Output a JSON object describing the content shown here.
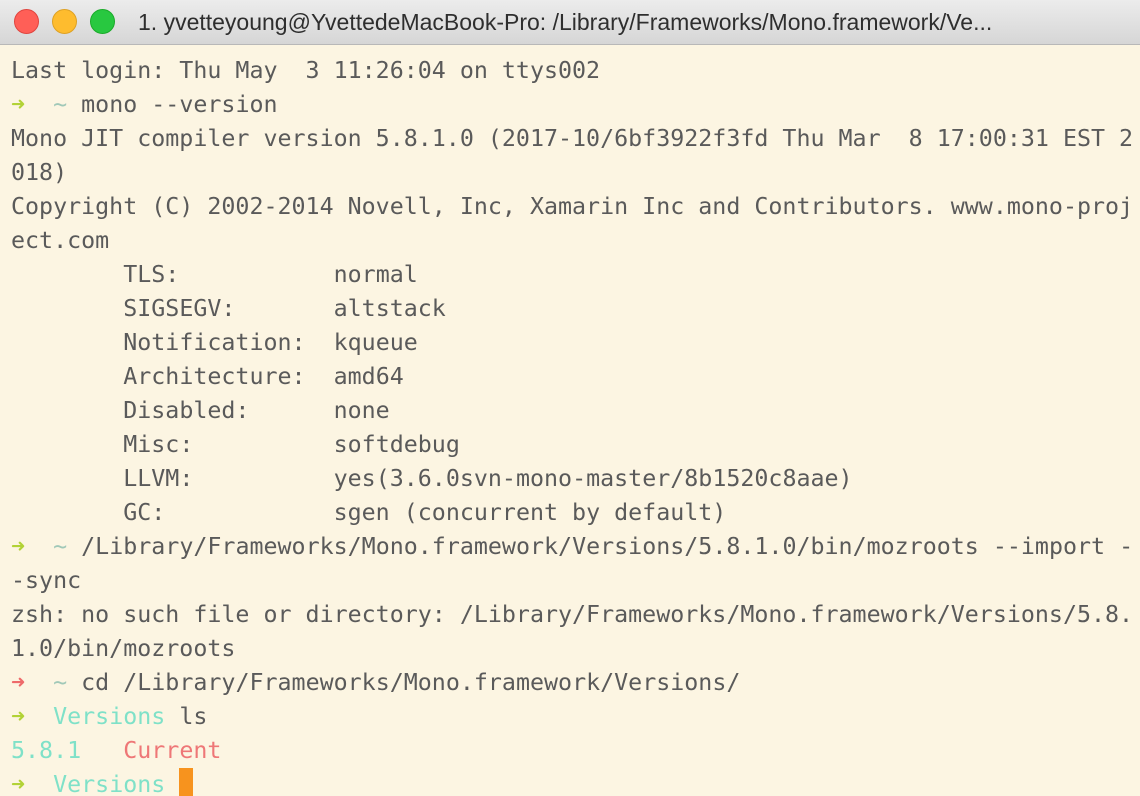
{
  "window": {
    "title": "1. yvetteyoung@YvettedeMacBook-Pro: /Library/Frameworks/Mono.framework/Ve..."
  },
  "prompt": {
    "arrow": "➜",
    "home": "~",
    "dir": "Versions"
  },
  "terminal": {
    "login": "Last login: Thu May  3 11:26:04 on ttys002",
    "cmd1": "mono --version",
    "out1a": "Mono JIT compiler version 5.8.1.0 (2017-10/6bf3922f3fd Thu Mar  8 17:00:31 EST 2",
    "out1b": "018)",
    "out1c": "Copyright (C) 2002-2014 Novell, Inc, Xamarin Inc and Contributors. www.mono-proj",
    "out1d": "ect.com",
    "features": [
      {
        "key": "TLS:",
        "value": "normal"
      },
      {
        "key": "SIGSEGV:",
        "value": "altstack"
      },
      {
        "key": "Notification:",
        "value": "kqueue"
      },
      {
        "key": "Architecture:",
        "value": "amd64"
      },
      {
        "key": "Disabled:",
        "value": "none"
      },
      {
        "key": "Misc:",
        "value": "softdebug"
      },
      {
        "key": "LLVM:",
        "value": "yes(3.6.0svn-mono-master/8b1520c8aae)"
      },
      {
        "key": "GC:",
        "value": "sgen (concurrent by default)"
      }
    ],
    "cmd2a": "/Library/Frameworks/Mono.framework/Versions/5.8.1.0/bin/mozroots --import -",
    "cmd2b": "-sync",
    "err1": "zsh: no such file or directory: /Library/Frameworks/Mono.framework/Versions/5.8.",
    "err2": "1.0/bin/mozroots",
    "cmd3": "cd /Library/Frameworks/Mono.framework/Versions/",
    "cmd4": "ls",
    "ls_items": [
      "5.8.1",
      "Current"
    ]
  },
  "colors": {
    "background": "#fcf5e2",
    "text": "#5a5a5a",
    "prompt_ok": "#b2d236",
    "prompt_error": "#ee6a6a",
    "directory": "#7fe1c8",
    "symlink": "#ee7777",
    "cursor": "#f7931e"
  }
}
